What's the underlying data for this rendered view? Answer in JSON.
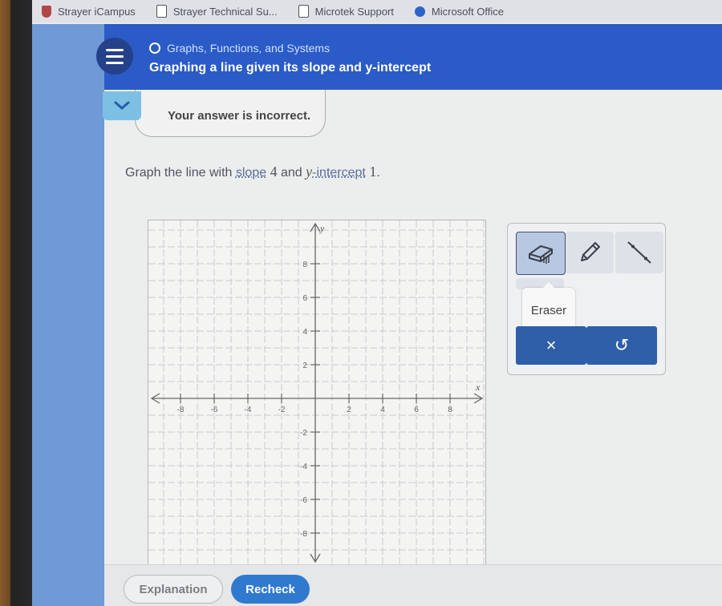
{
  "bookmarks": [
    {
      "label": "Strayer iCampus",
      "icon": "shield-icon"
    },
    {
      "label": "Strayer Technical Su...",
      "icon": "document-icon"
    },
    {
      "label": "Microtek Support",
      "icon": "document-icon"
    },
    {
      "label": "Microsoft Office",
      "icon": "microsoft-office-icon"
    }
  ],
  "header": {
    "topic": "Graphs, Functions, and Systems",
    "lesson": "Graphing a line given its slope and y-intercept",
    "menu_icon": "hamburger-menu-icon"
  },
  "feedback": {
    "message": "Your answer is incorrect.",
    "collapse_icon": "chevron-down-icon"
  },
  "question": {
    "prefix": "Graph the line with ",
    "slope_term": "slope",
    "slope_value": "4",
    "middle": " and ",
    "y_var": "y",
    "intercept_term": "-intercept",
    "intercept_value": "1",
    "suffix": "."
  },
  "graph": {
    "x_label": "x",
    "y_label": "y",
    "x_range": [
      -10,
      10
    ],
    "y_range": [
      -10,
      10
    ],
    "grid_step": 1,
    "x_tick_labels": [
      "-8",
      "-6",
      "-4",
      "-2",
      "2",
      "4",
      "6",
      "8"
    ],
    "y_tick_labels": [
      "8",
      "6",
      "4",
      "2",
      "-2",
      "-4",
      "-6",
      "-8"
    ],
    "x_tick_values": [
      -8,
      -6,
      -4,
      -2,
      2,
      4,
      6,
      8
    ],
    "y_tick_values": [
      8,
      6,
      4,
      2,
      -2,
      -4,
      -6,
      -8
    ]
  },
  "tools": {
    "items": [
      {
        "name": "eraser",
        "icon": "eraser-icon",
        "selected": true
      },
      {
        "name": "pencil",
        "icon": "pencil-icon",
        "selected": false
      },
      {
        "name": "line",
        "icon": "line-segment-icon",
        "selected": false
      }
    ],
    "tooltip": "Eraser",
    "clear_label": "×",
    "undo_label": "↺"
  },
  "footer": {
    "explanation_label": "Explanation",
    "recheck_label": "Recheck"
  },
  "colors": {
    "header_blue": "#2a5bc6",
    "recheck_blue": "#2f79cf",
    "action_blue": "#2f5fa8"
  }
}
